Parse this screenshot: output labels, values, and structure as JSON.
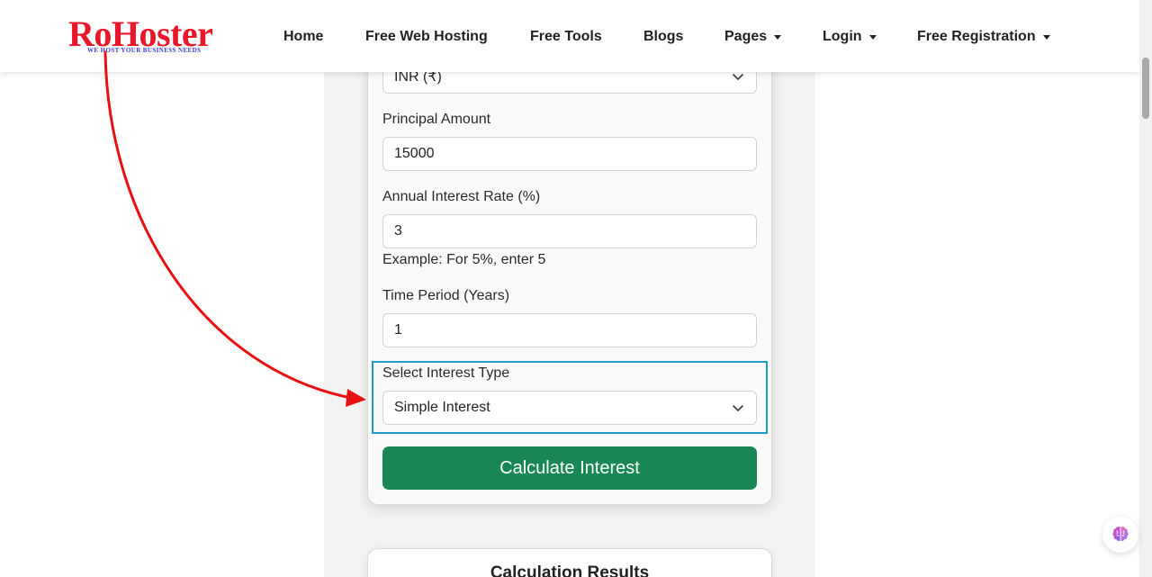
{
  "navbar": {
    "logo_text": "RoHoster",
    "logo_tagline": "WE HOST YOUR BUSINESS NEEDS",
    "items": [
      {
        "label": "Home",
        "has_dropdown": false
      },
      {
        "label": "Free Web Hosting",
        "has_dropdown": false
      },
      {
        "label": "Free Tools",
        "has_dropdown": false
      },
      {
        "label": "Blogs",
        "has_dropdown": false
      },
      {
        "label": "Pages",
        "has_dropdown": true
      },
      {
        "label": "Login",
        "has_dropdown": true
      },
      {
        "label": "Free Registration",
        "has_dropdown": true
      }
    ]
  },
  "form": {
    "currency": {
      "selected": "INR (₹)"
    },
    "principal": {
      "label": "Principal Amount",
      "value": "15000"
    },
    "rate": {
      "label": "Annual Interest Rate (%)",
      "value": "3",
      "hint": "Example: For 5%, enter 5"
    },
    "period": {
      "label": "Time Period (Years)",
      "value": "1"
    },
    "interest_type": {
      "label": "Select Interest Type",
      "selected": "Simple Interest"
    },
    "submit_label": "Calculate Interest"
  },
  "results": {
    "title": "Calculation Results"
  },
  "colors": {
    "brand_red": "#e8182a",
    "brand_blue": "#3b3bd9",
    "button_green": "#198754",
    "highlight_blue": "#1da1c7",
    "annotation_arrow": "#e81010"
  },
  "icons": {
    "select_chevron": "chevron-down-icon",
    "fab": "brain-icon"
  }
}
